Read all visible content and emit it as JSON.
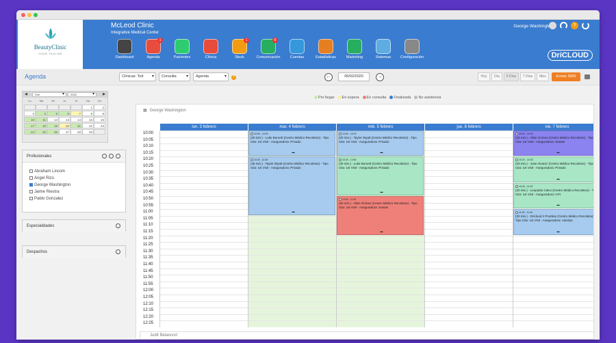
{
  "header": {
    "clinic_name": "McLeod Clinic",
    "clinic_subtitle": "Integrative Medical Center",
    "logo_name": "BeautyClinic",
    "logo_tagline": "YOUR TAGLINE",
    "user_name": "George Washington",
    "brand": "DriCLOUD",
    "nav": [
      {
        "label": "Dashboard",
        "color": "#444444",
        "badge": ""
      },
      {
        "label": "Agenda",
        "color": "#e74c3c",
        "badge": "1"
      },
      {
        "label": "Pacientes",
        "color": "#2ecc71",
        "badge": ""
      },
      {
        "label": "Clínica",
        "color": "#e74c3c",
        "badge": ""
      },
      {
        "label": "Stock",
        "color": "#f39c12",
        "badge": "1"
      },
      {
        "label": "Comunicación",
        "color": "#27ae60",
        "badge": "8"
      },
      {
        "label": "Cuentas",
        "color": "#3498db",
        "badge": ""
      },
      {
        "label": "Estadísticas",
        "color": "#e67e22",
        "badge": ""
      },
      {
        "label": "Marketing",
        "color": "#27ae60",
        "badge": ""
      },
      {
        "label": "Sistemas",
        "color": "#5dade2",
        "badge": ""
      },
      {
        "label": "Configuración",
        "color": "#888888",
        "badge": ""
      }
    ]
  },
  "toolbar": {
    "title": "Agenda",
    "clinicas": "Clínicas: Tod",
    "consulta": "Consulta",
    "agenda": "Agenda",
    "date": "06/02/2020",
    "views": [
      "Hoy",
      "Día",
      "5 Días",
      "7 Días",
      "Mes"
    ],
    "sms_label": "Enviar SMS"
  },
  "mini_calendar": {
    "month": "Feb",
    "year": "2020",
    "weekdays": [
      "Lu",
      "Ma",
      "Mi",
      "Ju",
      "Vi",
      "Sá",
      "Do"
    ],
    "weeks": [
      [
        "",
        "",
        "",
        "",
        "",
        "1",
        "2"
      ],
      [
        "3",
        "4",
        "5",
        "6",
        "7",
        "8",
        "9"
      ],
      [
        "10",
        "11",
        "12",
        "13",
        "14",
        "15",
        "16"
      ],
      [
        "17",
        "18",
        "19",
        "20",
        "21",
        "22",
        "23"
      ],
      [
        "24",
        "25",
        "26",
        "27",
        "28",
        "29",
        ""
      ]
    ]
  },
  "profesionales": {
    "title": "Profesionales",
    "items": [
      {
        "name": "Abraham Lincoln",
        "checked": false
      },
      {
        "name": "Angel Rizo",
        "checked": false
      },
      {
        "name": "George Washington",
        "checked": true
      },
      {
        "name": "Jaime Riestra",
        "checked": false
      },
      {
        "name": "Pablo Gonzalez",
        "checked": false
      }
    ]
  },
  "especialidades": {
    "title": "Especialidades"
  },
  "despachos": {
    "title": "Despachos"
  },
  "legend": [
    {
      "label": "Por llegar",
      "color": "#c8eab0"
    },
    {
      "label": "En espera",
      "color": "#f7f0a0"
    },
    {
      "label": "En consulta",
      "color": "#ef8079"
    },
    {
      "label": "Finalizada",
      "color": "#3a7ccf"
    },
    {
      "label": "No asistencia",
      "color": "#bbbbbb"
    }
  ],
  "schedule": {
    "doctor": "George Washington",
    "second_doctor": "Judit Betancort",
    "days": [
      "lun. 3 febrero",
      "mar. 4 febrero",
      "mié. 5 febrero",
      "jue. 6 febrero",
      "vie. 7 febrero"
    ],
    "times": [
      "10:00",
      "10:05",
      "10:10",
      "10:15",
      "10:20",
      "10:25",
      "10:30",
      "10:35",
      "10:40",
      "10:45",
      "10:50",
      "10:55",
      "11:00",
      "11:05",
      "11:10",
      "11:15",
      "11:20",
      "11:25",
      "11:30",
      "11:35",
      "11:40",
      "11:45",
      "11:50",
      "11:55",
      "12:00",
      "12:05",
      "12:10",
      "12:15",
      "12:20",
      "12:25"
    ],
    "appointments": [
      {
        "day": 1,
        "start": 0,
        "slots": 4,
        "color": "blue",
        "time": "10:00 - 10:20",
        "text": "(20 min.) - Luke Burnett (Centro Médico Recoletos) - Tipo Cita: 1st Visit - Aseguradora: Privado"
      },
      {
        "day": 1,
        "start": 4,
        "slots": 9,
        "color": "blue",
        "time": "10:20 - 11:05",
        "text": "(45 min.) - Taylor Wyatt (Centro Médico Recoletos) - Tipo Cita: 1st Visit - Aseguradora: Privado"
      },
      {
        "day": 2,
        "start": 0,
        "slots": 4,
        "color": "blue",
        "time": "10:00 - 10:20",
        "text": "(20 min.) - Taylor Wyatt (Centro Médico Recoletos) - Tipo Cita: 1st Visit - Aseguradora: Privado"
      },
      {
        "day": 2,
        "start": 4,
        "slots": 6,
        "color": "mint",
        "time": "10:20 - 10:50",
        "text": "(30 min.) - Luke Burnett (Centro Médico Recoletos) - Tipo Cita: 1st Visit - Aseguradora: Privado"
      },
      {
        "day": 2,
        "start": 10,
        "slots": 6,
        "color": "red",
        "time": "10:50 - 11:20",
        "text": "(30 min.) - Allan Grimes (Centro Médico Recoletos) - Tipo Cita: 1st Visit - Aseguradora: Santas"
      },
      {
        "day": 4,
        "start": 0,
        "slots": 4,
        "color": "violet",
        "time": "10:00 - 10:20",
        "text": "(20 min.) - Allan Grimes (Centro Médico Recoletos) - Tipo Cita: 1st Visit - Aseguradora: Santas"
      },
      {
        "day": 4,
        "start": 4,
        "slots": 4,
        "color": "mint",
        "time": "10:20 - 10:40",
        "text": "(20 min.) - Jose Alvarez (Centro Médico Recoletos) - Tipo Cita: 1st Visit - Aseguradora: Privado"
      },
      {
        "day": 4,
        "start": 8,
        "slots": 4,
        "color": "mint",
        "time": "10:40 - 11:20",
        "text": "(20 min.) - Leopoldo Calvo (Centro Médico Recoletos) - Tipo Cita: 1st Visit - Aseguradora: IATI"
      },
      {
        "day": 4,
        "start": 12,
        "slots": 4,
        "color": "blue",
        "time": "11:00 - 11:20",
        "text": "(20 min.) - Dricloud 2 Pruebas (Centro Médico Recoletos) - Tipo Cita: 1st Visit - Aseguradora: Adeslas"
      }
    ]
  }
}
